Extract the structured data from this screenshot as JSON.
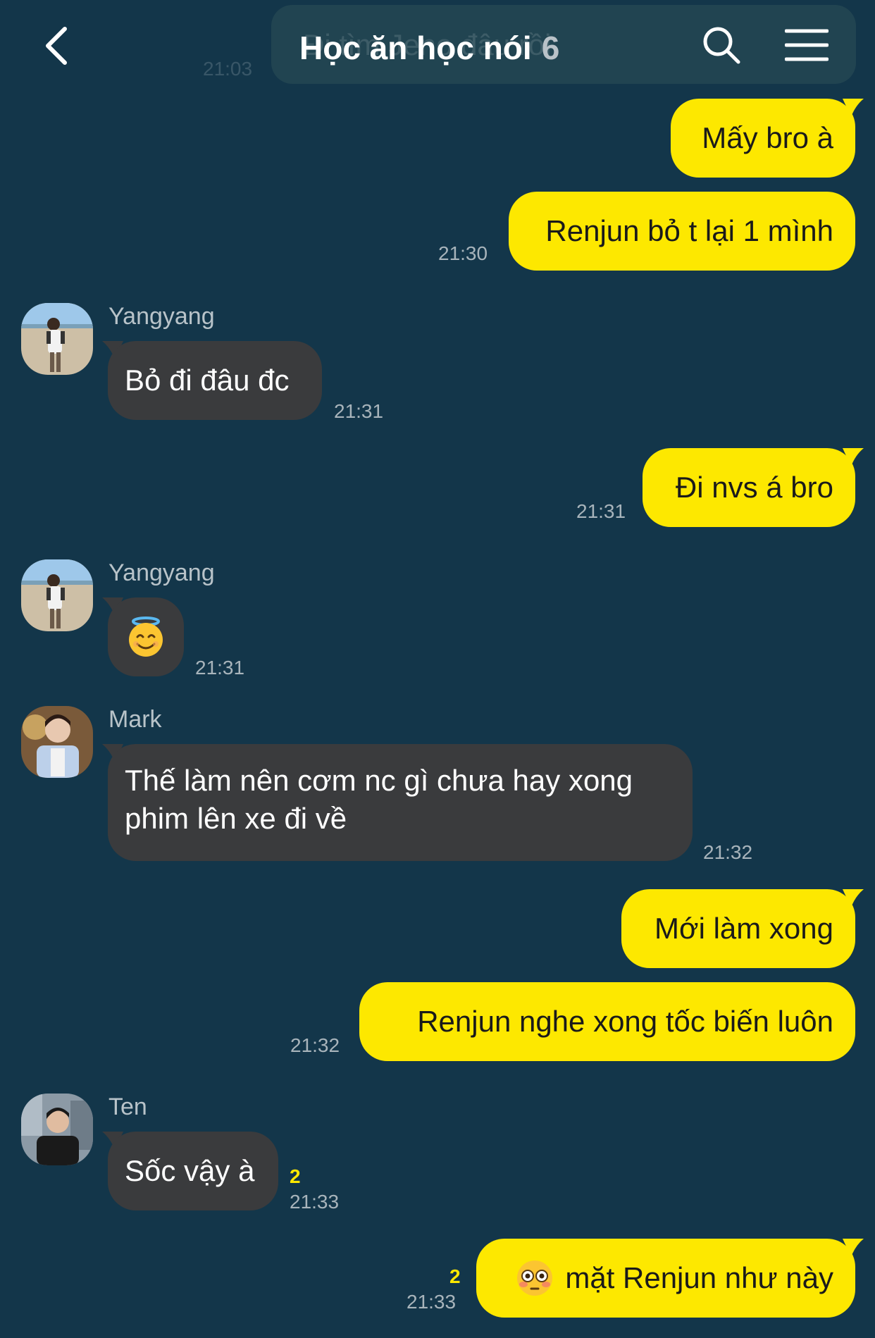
{
  "header": {
    "title": "Học ăn học nói",
    "member_count": "6",
    "background_message_preview": "Đi tìm Jeno đâu rồi",
    "background_time": "21:03",
    "icons": {
      "back": "chevron-left-icon",
      "search": "search-icon",
      "menu": "hamburger-menu-icon"
    }
  },
  "colors": {
    "background": "#13364a",
    "my_bubble": "#fde800",
    "their_bubble": "#3a3b3d",
    "time_text": "#a8b4bb",
    "unread_count": "#fde800"
  },
  "messages": [
    {
      "id": "m1",
      "side": "me",
      "text": "Mấy bro à"
    },
    {
      "id": "m2",
      "side": "me",
      "text": "Renjun bỏ t lại 1 mình",
      "time": "21:30"
    },
    {
      "id": "m3",
      "side": "them",
      "sender": "Yangyang",
      "text": "Bỏ đi đâu đc",
      "time": "21:31"
    },
    {
      "id": "m4",
      "side": "me",
      "text": "Đi nvs á bro",
      "time": "21:31"
    },
    {
      "id": "m5",
      "side": "them",
      "sender": "Yangyang",
      "emoji": "smiling-face-with-halo",
      "time": "21:31"
    },
    {
      "id": "m6",
      "side": "them",
      "sender": "Mark",
      "text_line1": "Thế làm nên cơm nc gì chưa hay xong",
      "text_line2": "phim lên xe đi về",
      "time": "21:32"
    },
    {
      "id": "m7",
      "side": "me",
      "text": "Mới làm xong"
    },
    {
      "id": "m8",
      "side": "me",
      "text": "Renjun nghe xong tốc biến luôn",
      "time": "21:32"
    },
    {
      "id": "m9",
      "side": "them",
      "sender": "Ten",
      "text": "Sốc vậy à",
      "unread": "2",
      "time": "21:33"
    },
    {
      "id": "m10",
      "side": "me",
      "emoji": "flushed-face",
      "text": "mặt Renjun như này",
      "unread": "2",
      "time": "21:33"
    }
  ]
}
